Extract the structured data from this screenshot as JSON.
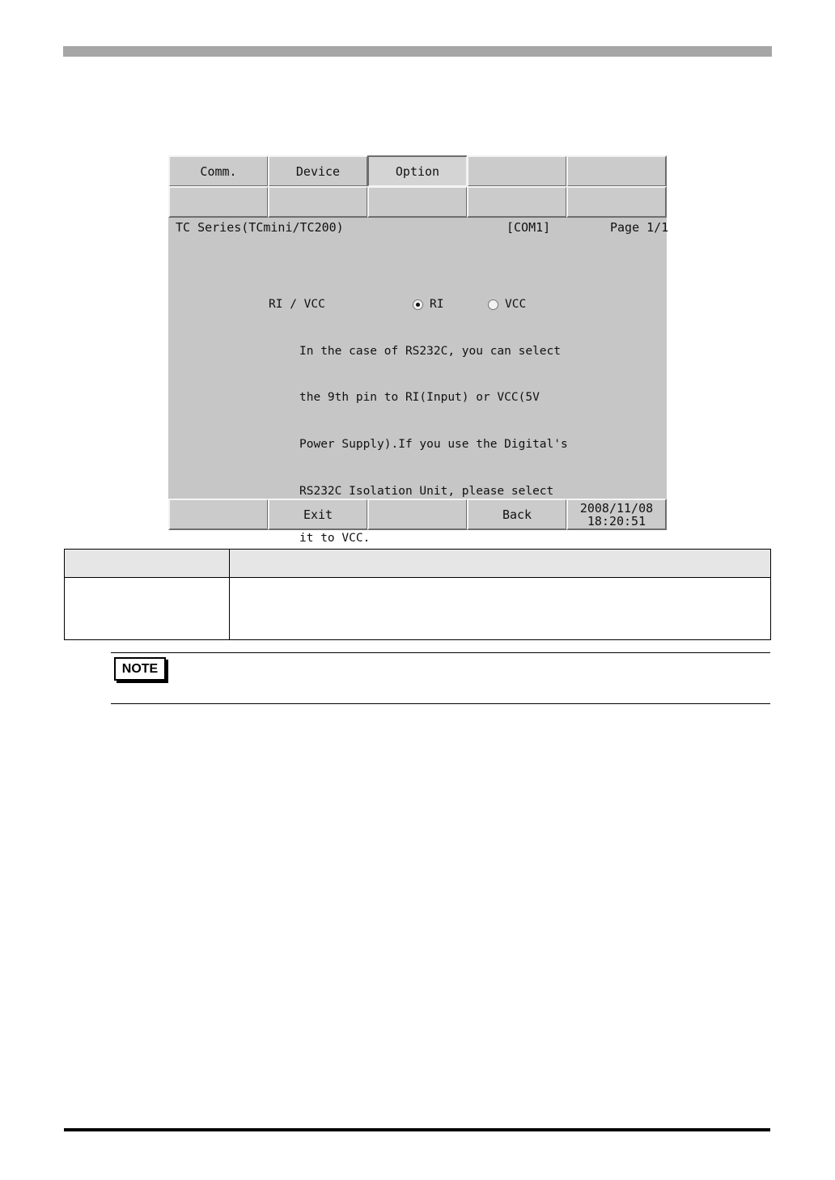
{
  "panel": {
    "tabs_row1": [
      "Comm.",
      "Device",
      "Option",
      "",
      ""
    ],
    "tabs_row2": [
      "",
      "",
      "",
      "",
      ""
    ],
    "active_tab_index": 2,
    "header": {
      "device": "TC Series(TCmini/TC200)",
      "port": "[COM1]",
      "page": "Page 1/1"
    },
    "setting": {
      "label": "RI / VCC",
      "options": [
        "RI",
        "VCC"
      ],
      "selected": "RI",
      "description": [
        "In the case of RS232C, you can select",
        "the 9th pin to RI(Input) or VCC(5V",
        "Power Supply).If you use the Digital's",
        "RS232C Isolation Unit, please select",
        "it to VCC."
      ]
    },
    "footer": {
      "buttons": [
        "",
        "Exit",
        "",
        "Back"
      ],
      "date": "2008/11/08",
      "time": "18:20:51"
    }
  },
  "note": {
    "badge": "NOTE"
  },
  "colors": {
    "panel_bg": "#c6c6c6",
    "top_bar": "#a6a6a6",
    "table_header": "#e6e6e6"
  }
}
